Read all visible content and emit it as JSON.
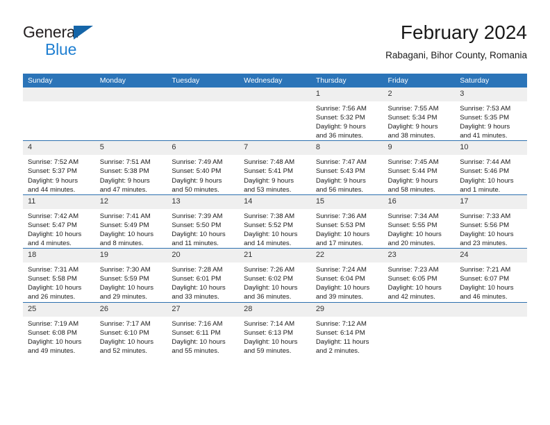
{
  "brand": {
    "line1": "General",
    "line2": "Blue",
    "triangle_color": "#1565a8",
    "blue_text_color": "#1f7fd1"
  },
  "header": {
    "title": "February 2024",
    "subtitle": "Rabagani, Bihor County, Romania"
  },
  "theme": {
    "header_blue": "#2b74b8",
    "row_divider_blue": "#2b6fae",
    "daynum_gray": "#efefef"
  },
  "calendar": {
    "weekday_headers": [
      "Sunday",
      "Monday",
      "Tuesday",
      "Wednesday",
      "Thursday",
      "Friday",
      "Saturday"
    ],
    "weeks": [
      [
        {
          "day": "",
          "sunrise": "",
          "sunset": "",
          "daylight1": "",
          "daylight2": ""
        },
        {
          "day": "",
          "sunrise": "",
          "sunset": "",
          "daylight1": "",
          "daylight2": ""
        },
        {
          "day": "",
          "sunrise": "",
          "sunset": "",
          "daylight1": "",
          "daylight2": ""
        },
        {
          "day": "",
          "sunrise": "",
          "sunset": "",
          "daylight1": "",
          "daylight2": ""
        },
        {
          "day": "1",
          "sunrise": "Sunrise: 7:56 AM",
          "sunset": "Sunset: 5:32 PM",
          "daylight1": "Daylight: 9 hours",
          "daylight2": "and 36 minutes."
        },
        {
          "day": "2",
          "sunrise": "Sunrise: 7:55 AM",
          "sunset": "Sunset: 5:34 PM",
          "daylight1": "Daylight: 9 hours",
          "daylight2": "and 38 minutes."
        },
        {
          "day": "3",
          "sunrise": "Sunrise: 7:53 AM",
          "sunset": "Sunset: 5:35 PM",
          "daylight1": "Daylight: 9 hours",
          "daylight2": "and 41 minutes."
        }
      ],
      [
        {
          "day": "4",
          "sunrise": "Sunrise: 7:52 AM",
          "sunset": "Sunset: 5:37 PM",
          "daylight1": "Daylight: 9 hours",
          "daylight2": "and 44 minutes."
        },
        {
          "day": "5",
          "sunrise": "Sunrise: 7:51 AM",
          "sunset": "Sunset: 5:38 PM",
          "daylight1": "Daylight: 9 hours",
          "daylight2": "and 47 minutes."
        },
        {
          "day": "6",
          "sunrise": "Sunrise: 7:49 AM",
          "sunset": "Sunset: 5:40 PM",
          "daylight1": "Daylight: 9 hours",
          "daylight2": "and 50 minutes."
        },
        {
          "day": "7",
          "sunrise": "Sunrise: 7:48 AM",
          "sunset": "Sunset: 5:41 PM",
          "daylight1": "Daylight: 9 hours",
          "daylight2": "and 53 minutes."
        },
        {
          "day": "8",
          "sunrise": "Sunrise: 7:47 AM",
          "sunset": "Sunset: 5:43 PM",
          "daylight1": "Daylight: 9 hours",
          "daylight2": "and 56 minutes."
        },
        {
          "day": "9",
          "sunrise": "Sunrise: 7:45 AM",
          "sunset": "Sunset: 5:44 PM",
          "daylight1": "Daylight: 9 hours",
          "daylight2": "and 58 minutes."
        },
        {
          "day": "10",
          "sunrise": "Sunrise: 7:44 AM",
          "sunset": "Sunset: 5:46 PM",
          "daylight1": "Daylight: 10 hours",
          "daylight2": "and 1 minute."
        }
      ],
      [
        {
          "day": "11",
          "sunrise": "Sunrise: 7:42 AM",
          "sunset": "Sunset: 5:47 PM",
          "daylight1": "Daylight: 10 hours",
          "daylight2": "and 4 minutes."
        },
        {
          "day": "12",
          "sunrise": "Sunrise: 7:41 AM",
          "sunset": "Sunset: 5:49 PM",
          "daylight1": "Daylight: 10 hours",
          "daylight2": "and 8 minutes."
        },
        {
          "day": "13",
          "sunrise": "Sunrise: 7:39 AM",
          "sunset": "Sunset: 5:50 PM",
          "daylight1": "Daylight: 10 hours",
          "daylight2": "and 11 minutes."
        },
        {
          "day": "14",
          "sunrise": "Sunrise: 7:38 AM",
          "sunset": "Sunset: 5:52 PM",
          "daylight1": "Daylight: 10 hours",
          "daylight2": "and 14 minutes."
        },
        {
          "day": "15",
          "sunrise": "Sunrise: 7:36 AM",
          "sunset": "Sunset: 5:53 PM",
          "daylight1": "Daylight: 10 hours",
          "daylight2": "and 17 minutes."
        },
        {
          "day": "16",
          "sunrise": "Sunrise: 7:34 AM",
          "sunset": "Sunset: 5:55 PM",
          "daylight1": "Daylight: 10 hours",
          "daylight2": "and 20 minutes."
        },
        {
          "day": "17",
          "sunrise": "Sunrise: 7:33 AM",
          "sunset": "Sunset: 5:56 PM",
          "daylight1": "Daylight: 10 hours",
          "daylight2": "and 23 minutes."
        }
      ],
      [
        {
          "day": "18",
          "sunrise": "Sunrise: 7:31 AM",
          "sunset": "Sunset: 5:58 PM",
          "daylight1": "Daylight: 10 hours",
          "daylight2": "and 26 minutes."
        },
        {
          "day": "19",
          "sunrise": "Sunrise: 7:30 AM",
          "sunset": "Sunset: 5:59 PM",
          "daylight1": "Daylight: 10 hours",
          "daylight2": "and 29 minutes."
        },
        {
          "day": "20",
          "sunrise": "Sunrise: 7:28 AM",
          "sunset": "Sunset: 6:01 PM",
          "daylight1": "Daylight: 10 hours",
          "daylight2": "and 33 minutes."
        },
        {
          "day": "21",
          "sunrise": "Sunrise: 7:26 AM",
          "sunset": "Sunset: 6:02 PM",
          "daylight1": "Daylight: 10 hours",
          "daylight2": "and 36 minutes."
        },
        {
          "day": "22",
          "sunrise": "Sunrise: 7:24 AM",
          "sunset": "Sunset: 6:04 PM",
          "daylight1": "Daylight: 10 hours",
          "daylight2": "and 39 minutes."
        },
        {
          "day": "23",
          "sunrise": "Sunrise: 7:23 AM",
          "sunset": "Sunset: 6:05 PM",
          "daylight1": "Daylight: 10 hours",
          "daylight2": "and 42 minutes."
        },
        {
          "day": "24",
          "sunrise": "Sunrise: 7:21 AM",
          "sunset": "Sunset: 6:07 PM",
          "daylight1": "Daylight: 10 hours",
          "daylight2": "and 46 minutes."
        }
      ],
      [
        {
          "day": "25",
          "sunrise": "Sunrise: 7:19 AM",
          "sunset": "Sunset: 6:08 PM",
          "daylight1": "Daylight: 10 hours",
          "daylight2": "and 49 minutes."
        },
        {
          "day": "26",
          "sunrise": "Sunrise: 7:17 AM",
          "sunset": "Sunset: 6:10 PM",
          "daylight1": "Daylight: 10 hours",
          "daylight2": "and 52 minutes."
        },
        {
          "day": "27",
          "sunrise": "Sunrise: 7:16 AM",
          "sunset": "Sunset: 6:11 PM",
          "daylight1": "Daylight: 10 hours",
          "daylight2": "and 55 minutes."
        },
        {
          "day": "28",
          "sunrise": "Sunrise: 7:14 AM",
          "sunset": "Sunset: 6:13 PM",
          "daylight1": "Daylight: 10 hours",
          "daylight2": "and 59 minutes."
        },
        {
          "day": "29",
          "sunrise": "Sunrise: 7:12 AM",
          "sunset": "Sunset: 6:14 PM",
          "daylight1": "Daylight: 11 hours",
          "daylight2": "and 2 minutes."
        },
        {
          "day": "",
          "sunrise": "",
          "sunset": "",
          "daylight1": "",
          "daylight2": ""
        },
        {
          "day": "",
          "sunrise": "",
          "sunset": "",
          "daylight1": "",
          "daylight2": ""
        }
      ]
    ]
  }
}
